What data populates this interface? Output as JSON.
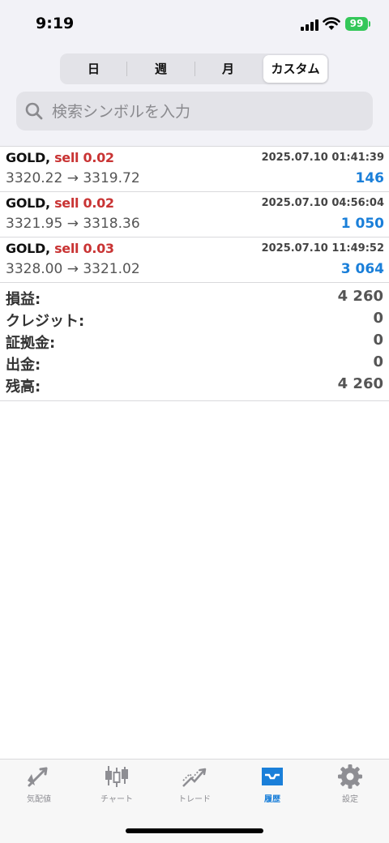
{
  "status_bar": {
    "time": "9:19",
    "battery": "99"
  },
  "period_tabs": [
    {
      "label": "日",
      "active": false
    },
    {
      "label": "週",
      "active": false
    },
    {
      "label": "月",
      "active": false
    },
    {
      "label": "カスタム",
      "active": true
    }
  ],
  "search": {
    "placeholder": "検索シンボルを入力"
  },
  "trades": [
    {
      "symbol": "GOLD,",
      "side": "sell 0.02",
      "datetime": "2025.07.10 01:41:39",
      "prices": "3320.22 → 3319.72",
      "profit": "146"
    },
    {
      "symbol": "GOLD,",
      "side": "sell 0.02",
      "datetime": "2025.07.10 04:56:04",
      "prices": "3321.95 → 3318.36",
      "profit": "1 050"
    },
    {
      "symbol": "GOLD,",
      "side": "sell 0.03",
      "datetime": "2025.07.10 11:49:52",
      "prices": "3328.00 → 3321.02",
      "profit": "3 064"
    }
  ],
  "summary": [
    {
      "label": "損益:",
      "value": "4 260"
    },
    {
      "label": "クレジット:",
      "value": "0"
    },
    {
      "label": "証拠金:",
      "value": "0"
    },
    {
      "label": "出金:",
      "value": "0"
    },
    {
      "label": "残高:",
      "value": "4 260"
    }
  ],
  "tabbar": [
    {
      "label": "気配値",
      "icon": "quotes-icon",
      "active": false
    },
    {
      "label": "チャート",
      "icon": "chart-icon",
      "active": false
    },
    {
      "label": "トレード",
      "icon": "trade-icon",
      "active": false
    },
    {
      "label": "履歴",
      "icon": "history-icon",
      "active": true
    },
    {
      "label": "設定",
      "icon": "settings-icon",
      "active": false
    }
  ],
  "colors": {
    "accent": "#1a7fd9",
    "sell": "#c93434",
    "battery": "#34c759"
  }
}
